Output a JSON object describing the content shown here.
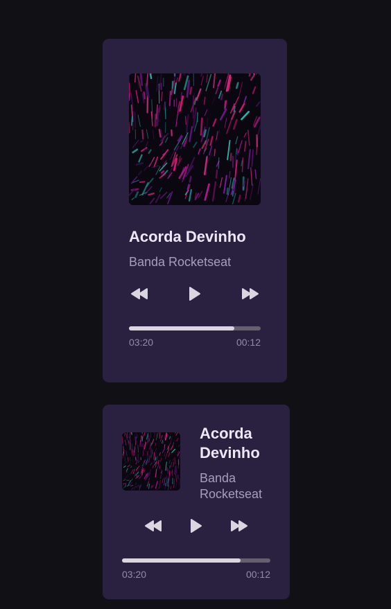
{
  "colors": {
    "page_background": "#111015",
    "card_background": "#2a2141",
    "title_text": "#ece8f5",
    "artist_text": "#a79fba",
    "time_text": "#948ca6",
    "progress_track": "#65606f",
    "progress_fill": "#d9d6e0",
    "icon_fill": "#d9d6e0"
  },
  "players": [
    {
      "layout": "large",
      "album_art": "abstract-magenta-teal-artwork",
      "title": "Acorda Devinho",
      "artist": "Banda Rocketseat",
      "controls": [
        "rewind-icon",
        "play-icon",
        "fast-forward-icon"
      ],
      "progress": 0.8,
      "time_elapsed": "03:20",
      "time_remaining": "00:12"
    },
    {
      "layout": "compact",
      "album_art": "abstract-magenta-teal-artwork",
      "title": "Acorda Devinho",
      "artist": "Banda Rocketseat",
      "controls": [
        "rewind-icon",
        "play-icon",
        "fast-forward-icon"
      ],
      "progress": 0.8,
      "time_elapsed": "03:20",
      "time_remaining": "00:12"
    }
  ]
}
